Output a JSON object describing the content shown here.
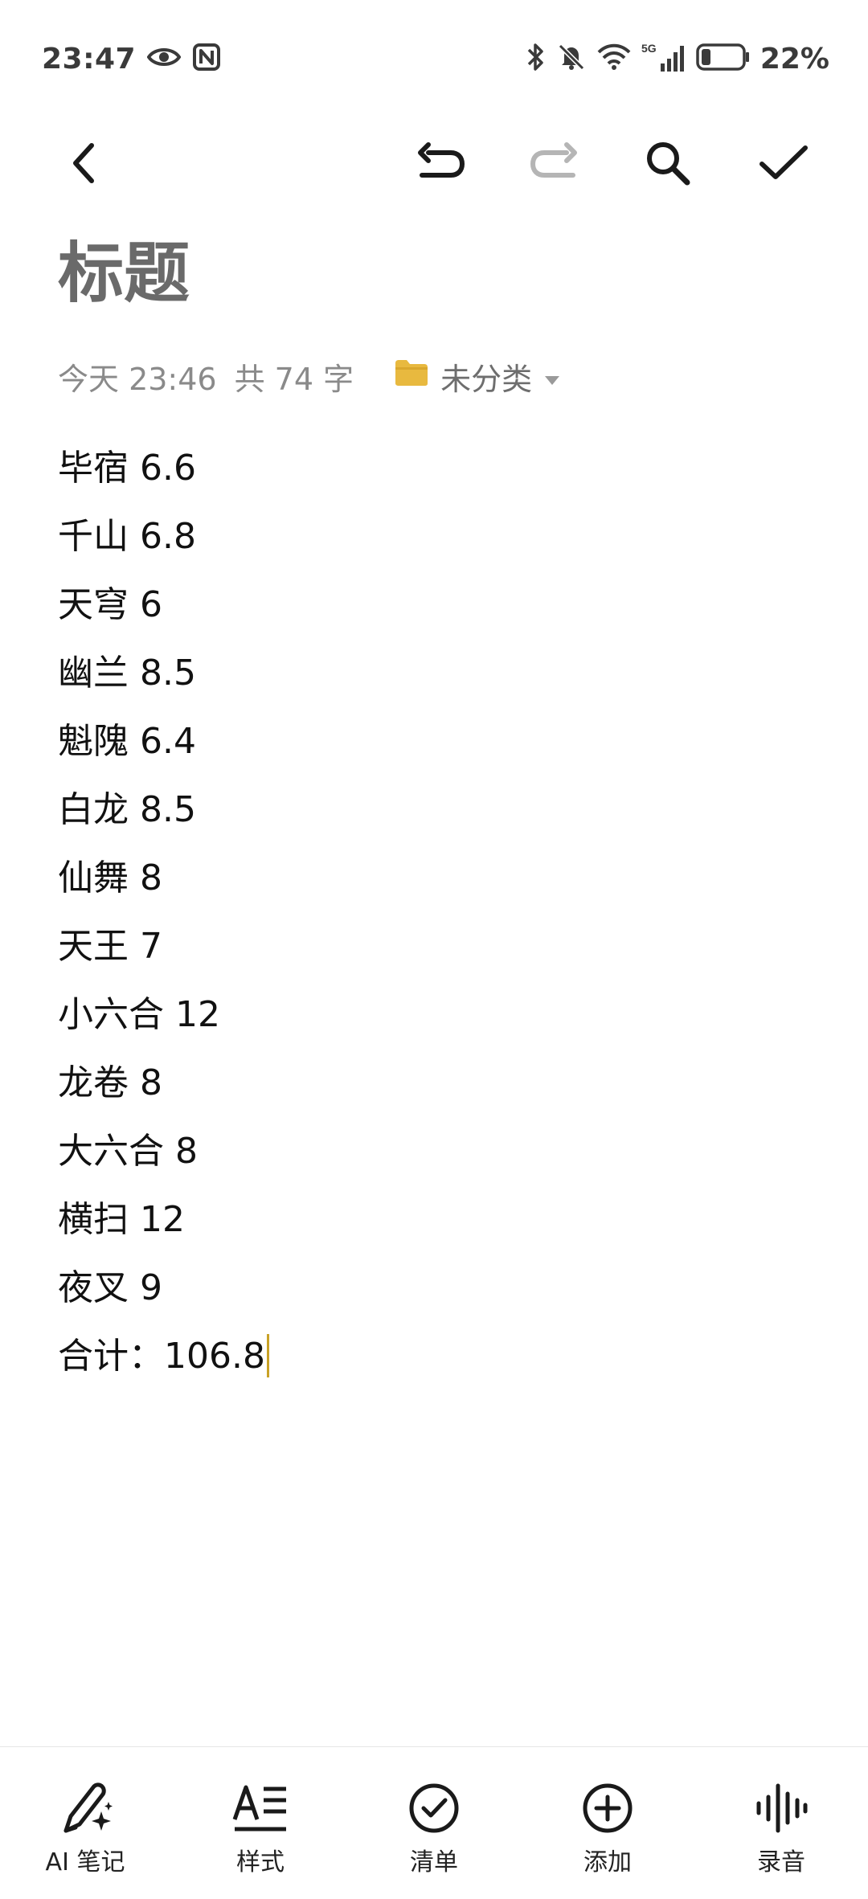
{
  "status_bar": {
    "time": "23:47",
    "battery_percent": "22%",
    "battery_level": 0.22,
    "network": "5G",
    "icons": [
      "eye-icon",
      "nfc-icon",
      "bluetooth-icon",
      "mute-icon",
      "wifi-icon",
      "signal-icon",
      "battery-icon"
    ]
  },
  "toolbar": {
    "icons": [
      "back-icon",
      "undo-icon",
      "redo-icon",
      "search-icon",
      "check-icon"
    ]
  },
  "note": {
    "title": "标题",
    "date": "今天 23:46",
    "word_count": "共 74 字",
    "folder": "未分类",
    "folder_color": "#E8B93F",
    "lines": [
      "毕宿 6.6",
      "千山 6.8",
      "天穹 6",
      "幽兰 8.5",
      "魁隗 6.4",
      "白龙 8.5",
      "仙舞 8",
      "天王 7",
      "小六合 12",
      "龙卷 8",
      "大六合 8",
      "横扫 12",
      "夜叉 9",
      "合计：106.8"
    ]
  },
  "bottom_bar": {
    "ai_note": "AI 笔记",
    "style": "样式",
    "checklist": "清单",
    "add": "添加",
    "record": "录音"
  },
  "colors": {
    "accent_cursor": "#C9A227",
    "title_gray": "#6A6A6A",
    "meta_gray": "#8A8A8A"
  }
}
